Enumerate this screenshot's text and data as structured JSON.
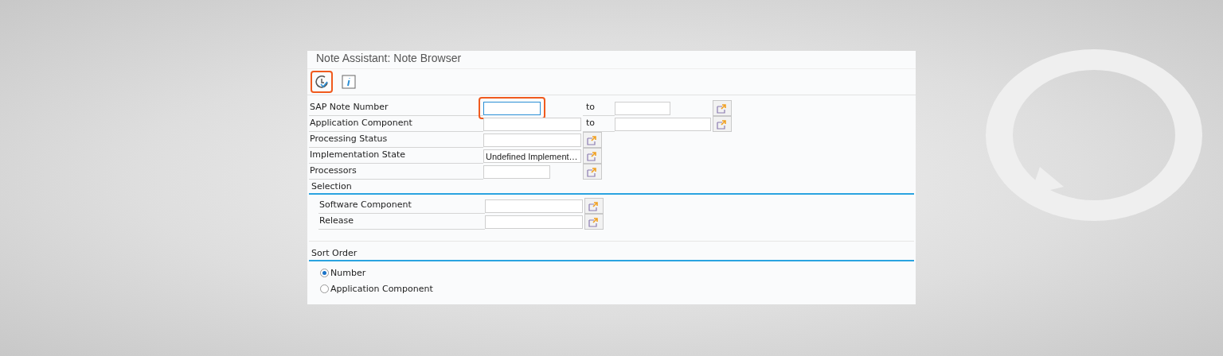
{
  "window": {
    "title": "Note Assistant: Note Browser"
  },
  "toolbar": [
    {
      "kind": "execute",
      "highlighted": true
    },
    {
      "kind": "info",
      "highlighted": false
    }
  ],
  "fields": [
    {
      "label": "SAP Note Number",
      "kind": "range",
      "to_label": "to",
      "highlighted": true,
      "focused": true
    },
    {
      "label": "Application Component",
      "kind": "range",
      "to_label": "to",
      "highlighted": false,
      "focused": false
    },
    {
      "label": "Processing Status",
      "kind": "single",
      "highlighted": false,
      "focused": false
    },
    {
      "label": "Implementation State",
      "kind": "single",
      "value": "Undefined Implement…",
      "highlighted": false,
      "focused": false
    },
    {
      "label": "Processors",
      "kind": "single",
      "highlighted": false,
      "focused": false
    }
  ],
  "selection": {
    "title": "Selection",
    "fields": [
      {
        "label": "Software Component",
        "kind": "single",
        "highlighted": false,
        "focused": false
      },
      {
        "label": "Release",
        "kind": "single",
        "highlighted": false,
        "focused": false
      }
    ]
  },
  "sort_order": {
    "title": "Sort Order",
    "options": [
      {
        "label": "Number",
        "selected": true
      },
      {
        "label": "Application Component",
        "selected": false
      }
    ]
  }
}
